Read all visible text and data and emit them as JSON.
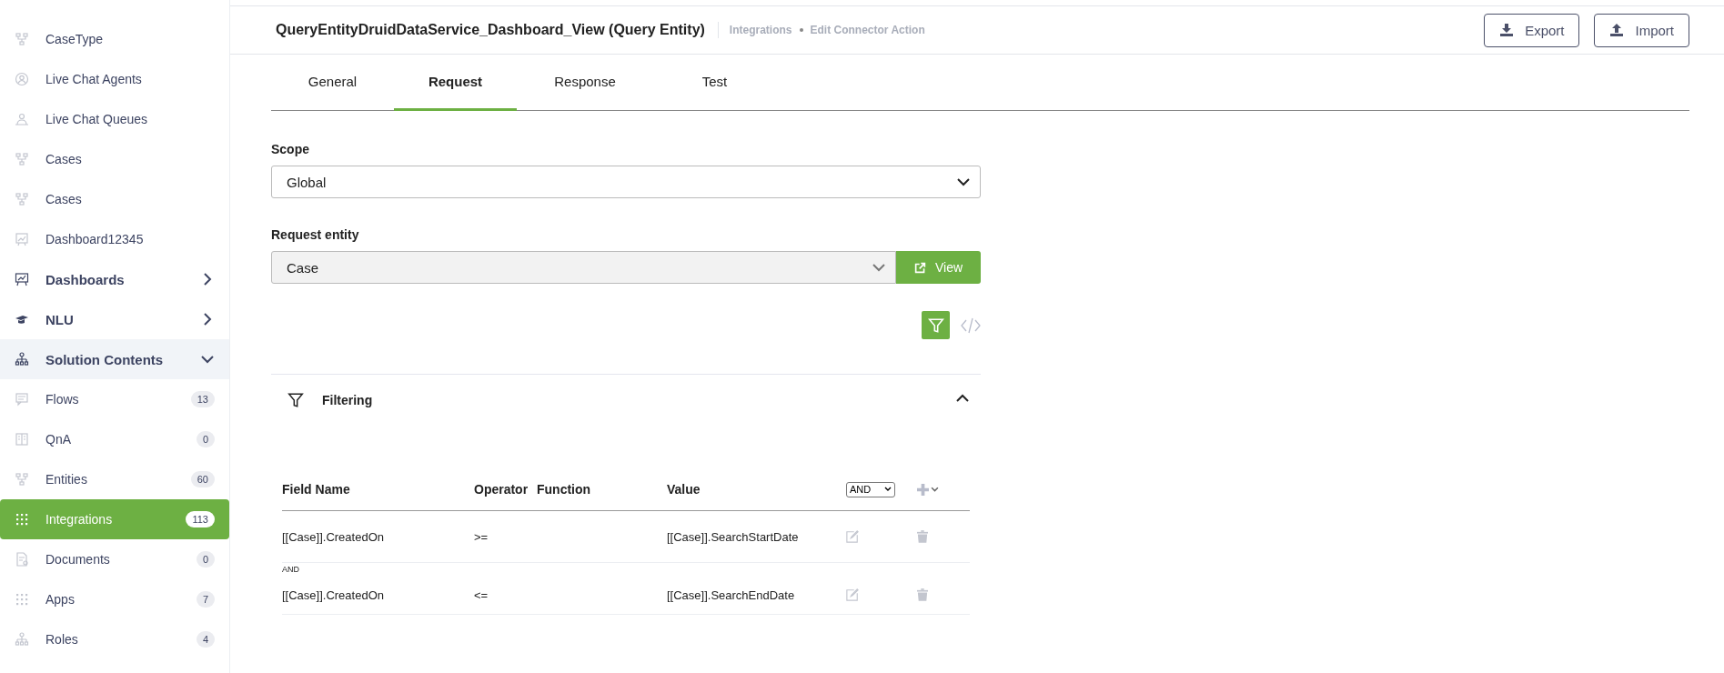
{
  "sidebar": {
    "items": [
      {
        "kind": "leaf",
        "label": "CaseType",
        "selected": false
      },
      {
        "kind": "leaf",
        "label": "Live Chat Agents",
        "selected": false
      },
      {
        "kind": "leaf",
        "label": "Live Chat Queues",
        "selected": false
      },
      {
        "kind": "leaf",
        "label": "Cases",
        "selected": false
      },
      {
        "kind": "leaf",
        "label": "Cases",
        "selected": false
      },
      {
        "kind": "leaf",
        "label": "Dashboard12345",
        "selected": false
      },
      {
        "kind": "group",
        "label": "Dashboards",
        "expanded": false
      },
      {
        "kind": "group",
        "label": "NLU",
        "expanded": false
      },
      {
        "kind": "group",
        "label": "Solution Contents",
        "expanded": true
      },
      {
        "kind": "leaf",
        "label": "Flows",
        "badge": "13",
        "selected": false
      },
      {
        "kind": "leaf",
        "label": "QnA",
        "badge": "0",
        "selected": false
      },
      {
        "kind": "leaf",
        "label": "Entities",
        "badge": "60",
        "selected": false
      },
      {
        "kind": "leaf",
        "label": "Integrations",
        "badge": "113",
        "selected": true
      },
      {
        "kind": "leaf",
        "label": "Documents",
        "badge": "0",
        "selected": false
      },
      {
        "kind": "leaf",
        "label": "Apps",
        "badge": "7",
        "selected": false
      },
      {
        "kind": "leaf",
        "label": "Roles",
        "badge": "4",
        "selected": false
      }
    ]
  },
  "header": {
    "title": "QueryEntityDruidDataService_Dashboard_View (Query Entity)",
    "breadcrumb": [
      "Integrations",
      "Edit Connector Action"
    ],
    "buttons": [
      {
        "kind": "export",
        "label": "Export"
      },
      {
        "kind": "import",
        "label": "Import"
      }
    ]
  },
  "tabs": [
    {
      "label": "General",
      "selected": false
    },
    {
      "label": "Request",
      "selected": true
    },
    {
      "label": "Response",
      "selected": false
    },
    {
      "label": "Test",
      "selected": false
    }
  ],
  "scope": {
    "label": "Scope",
    "value": "Global"
  },
  "request_entity": {
    "label": "Request entity",
    "value": "Case",
    "button": "View"
  },
  "mode": {
    "filter_selected": true
  },
  "filtering": {
    "title": "Filtering",
    "expanded": true,
    "columns": [
      "Field Name",
      "Operator",
      "Function",
      "Value"
    ],
    "logic": "AND",
    "rows": [
      {
        "field": "[[Case]].CreatedOn",
        "operator": ">=",
        "value": "[[Case]].SearchStartDate"
      },
      {
        "joiner": "AND",
        "field": "[[Case]].CreatedOn",
        "operator": "<=",
        "value": "[[Case]].SearchEndDate"
      }
    ]
  }
}
